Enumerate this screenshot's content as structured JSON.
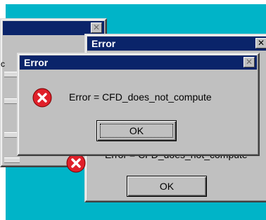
{
  "window_back_left": {
    "title": "",
    "close_glyph": "✕",
    "side_label": "c"
  },
  "dialog_back": {
    "title": "Error",
    "close_glyph": "✕",
    "message": "Error = CFD_does_not_compute",
    "ok_label": "OK",
    "icon": "error-x-icon"
  },
  "dialog_front": {
    "title": "Error",
    "close_glyph": "✕",
    "message": "Error = CFD_does_not_compute",
    "ok_label": "OK",
    "icon": "error-x-icon"
  },
  "colors": {
    "desktop_cyan": "#00b4c8",
    "titlebar_blue": "#0a246a",
    "face_gray": "#c0c0c0",
    "error_red": "#e0202a"
  }
}
